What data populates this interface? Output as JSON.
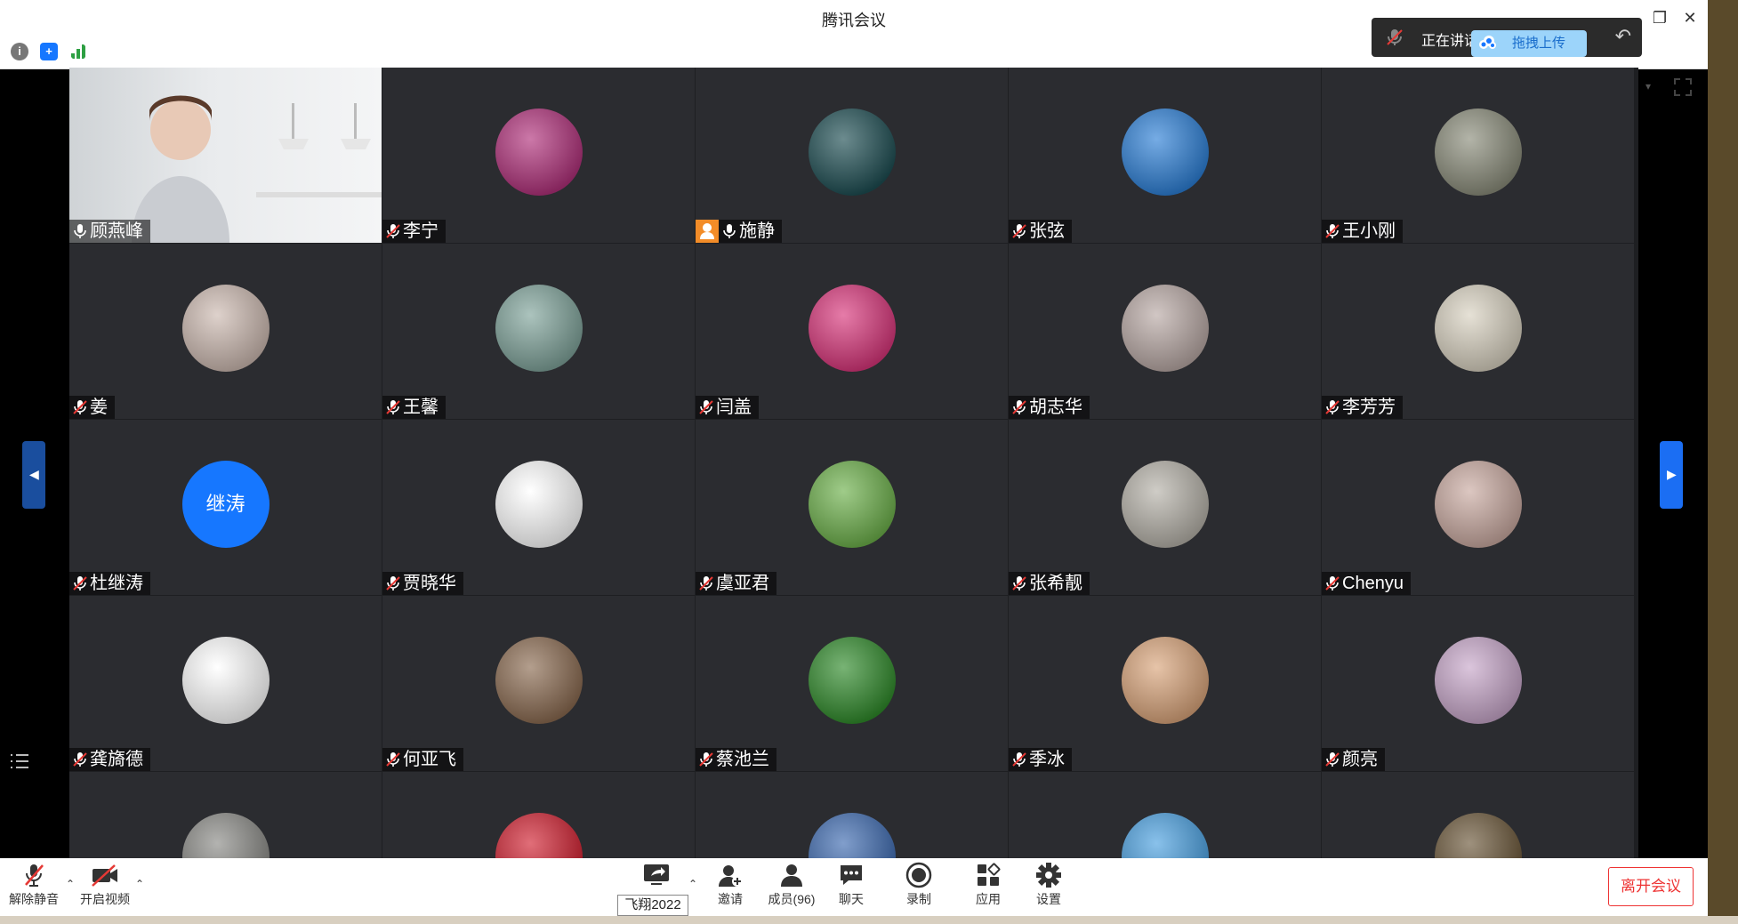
{
  "window": {
    "title": "腾讯会议",
    "controls": [
      "minimize-icon",
      "restore-icon",
      "close-icon"
    ]
  },
  "status_icons": [
    "info-icon",
    "shield-icon",
    "signal-icon"
  ],
  "speaking_panel": {
    "label": "正在讲话",
    "upload_label": "拖拽上传"
  },
  "participants": [
    {
      "name": "顾燕峰",
      "mic": "on",
      "avatar": "video"
    },
    {
      "name": "李宁",
      "mic": "muted",
      "avatar": "photo",
      "color": "#b0307a"
    },
    {
      "name": "施静",
      "mic": "on",
      "host": true,
      "avatar": "photo",
      "color": "#1d4d52"
    },
    {
      "name": "张弦",
      "mic": "muted",
      "avatar": "photo",
      "color": "#2c7fd6"
    },
    {
      "name": "王小刚",
      "mic": "muted",
      "avatar": "photo",
      "color": "#8a8c7a"
    },
    {
      "name": "姜",
      "mic": "muted",
      "avatar": "photo",
      "color": "#ccb9b0"
    },
    {
      "name": "王馨",
      "mic": "muted",
      "avatar": "photo",
      "color": "#7fa39a"
    },
    {
      "name": "闫盖",
      "mic": "muted",
      "avatar": "photo",
      "color": "#d8357a"
    },
    {
      "name": "胡志华",
      "mic": "muted",
      "avatar": "photo",
      "color": "#b8a8a4"
    },
    {
      "name": "李芳芳",
      "mic": "muted",
      "avatar": "photo",
      "color": "#d8d1c0"
    },
    {
      "name": "杜继涛",
      "mic": "muted",
      "avatar": "text",
      "avatar_text": "继涛",
      "color": "#1677ff"
    },
    {
      "name": "贾晓华",
      "mic": "muted",
      "avatar": "photo",
      "color": "#ffffff"
    },
    {
      "name": "虞亚君",
      "mic": "muted",
      "avatar": "photo",
      "color": "#6cb04a"
    },
    {
      "name": "张希靓",
      "mic": "muted",
      "avatar": "photo",
      "color": "#b5b1a8"
    },
    {
      "name": "Chenyu",
      "mic": "muted",
      "avatar": "photo",
      "color": "#c9a9a0"
    },
    {
      "name": "龚旖德",
      "mic": "muted",
      "avatar": "photo",
      "color": "#ffffff"
    },
    {
      "name": "何亚飞",
      "mic": "muted",
      "avatar": "photo",
      "color": "#8a6a50"
    },
    {
      "name": "蔡池兰",
      "mic": "muted",
      "avatar": "photo",
      "color": "#2f8a2a"
    },
    {
      "name": "季冰",
      "mic": "muted",
      "avatar": "photo",
      "color": "#d9a47a"
    },
    {
      "name": "颜亮",
      "mic": "muted",
      "avatar": "photo",
      "color": "#c7a6c9"
    },
    {
      "name": "",
      "mic": "",
      "avatar": "photo",
      "color": "#8a8a86"
    },
    {
      "name": "",
      "mic": "",
      "avatar": "photo",
      "color": "#d02030"
    },
    {
      "name": "",
      "mic": "",
      "avatar": "photo",
      "color": "#3d6ab0"
    },
    {
      "name": "",
      "mic": "",
      "avatar": "photo",
      "color": "#4aa0e0"
    },
    {
      "name": "",
      "mic": "",
      "avatar": "photo",
      "color": "#6a5638"
    }
  ],
  "toolbar": {
    "unmute": "解除静音",
    "start_video": "开启视频",
    "share": "",
    "share_tooltip": "飞翔2022",
    "invite": "邀请",
    "members": "成员(96)",
    "chat": "聊天",
    "record": "录制",
    "apps": "应用",
    "settings": "设置",
    "leave": "离开会议"
  },
  "colors": {
    "accent": "#1677ff",
    "leave": "#e53935",
    "muted_mic": "#e53935",
    "tile_bg": "#2b2c30"
  }
}
